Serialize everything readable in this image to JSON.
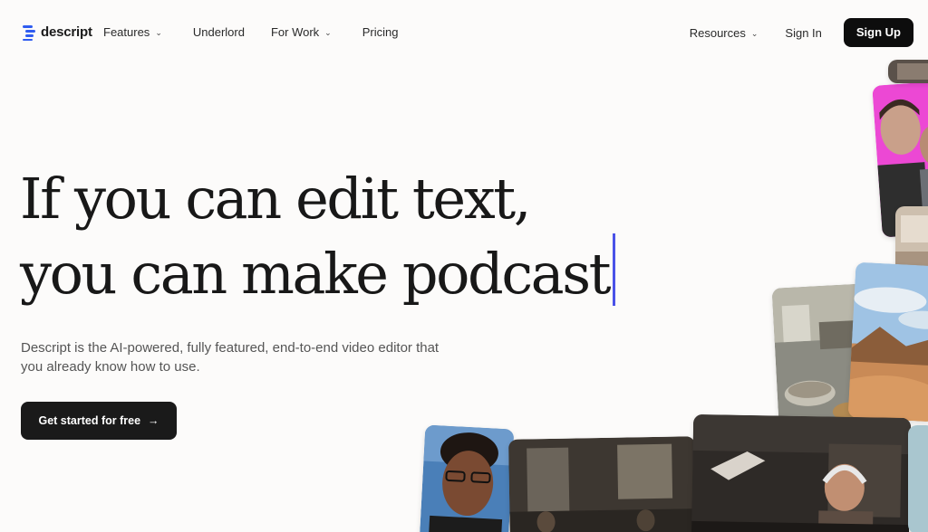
{
  "nav": {
    "logo_text": "descript",
    "links": [
      {
        "label": "Features",
        "has_dropdown": true
      },
      {
        "label": "Underlord",
        "has_dropdown": false
      },
      {
        "label": "For Work",
        "has_dropdown": true
      },
      {
        "label": "Pricing",
        "has_dropdown": false
      }
    ],
    "resources_label": "Resources",
    "signin_label": "Sign In",
    "signup_label": "Sign Up"
  },
  "hero": {
    "headline_line1": "If you can edit text,",
    "headline_line2": "you can make podcast",
    "subtext": "Descript is the AI-powered, fully featured, end-to-end video editor that you already know how to use.",
    "cta_label": "Get started for free",
    "cta_icon": "arrow-right-icon"
  },
  "colors": {
    "brand_blue": "#2f5cf0",
    "caret": "#4a52e8",
    "button_dark": "#0d0d0d"
  },
  "collage": {
    "tiles": [
      "man-with-glasses-portrait",
      "dim-living-room-scene",
      "woman-with-headphones-at-desk",
      "kitchen-cooking-scene",
      "desert-landscape",
      "two-men-pink-background",
      "room-interior"
    ]
  }
}
